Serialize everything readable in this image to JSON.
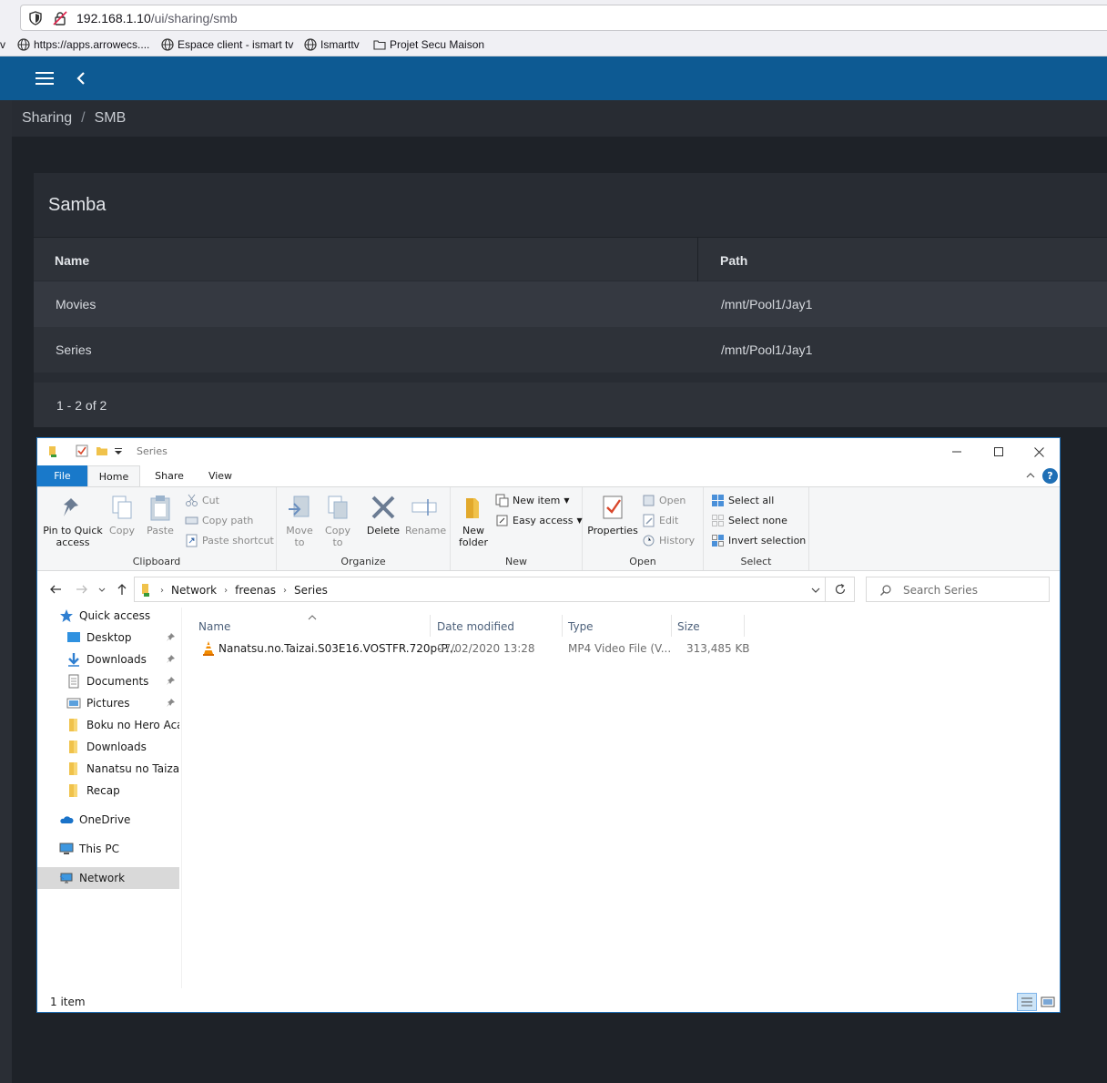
{
  "browser": {
    "url_host": "192.168.1.10",
    "url_path": "/ui/sharing/smb",
    "bookmarks": [
      {
        "label": "https://apps.arrowecs...."
      },
      {
        "label": "Espace client - ismart tv"
      },
      {
        "label": "Ismarttv"
      },
      {
        "label": "Projet Secu Maison"
      }
    ],
    "bookmark_edge": "v"
  },
  "app": {
    "breadcrumb": [
      "Sharing",
      "SMB"
    ],
    "breadcrumb_separator": "/",
    "card_title": "Samba",
    "columns": [
      "Name",
      "Path"
    ],
    "rows": [
      {
        "name": "Movies",
        "path": "/mnt/Pool1/Jay1"
      },
      {
        "name": "Series",
        "path": "/mnt/Pool1/Jay1"
      }
    ],
    "pagination": "1 - 2 of 2",
    "colors": {
      "topbar": "#0d5a93",
      "card": "#282c33",
      "background": "#1e2228"
    }
  },
  "explorer": {
    "title": "Series",
    "tabs": {
      "file": "File",
      "home": "Home",
      "share": "Share",
      "view": "View"
    },
    "ribbon": {
      "clipboard": {
        "label": "Clipboard",
        "pin": "Pin to Quick access",
        "copy": "Copy",
        "paste": "Paste",
        "cut": "Cut",
        "copy_path": "Copy path",
        "paste_shortcut": "Paste shortcut"
      },
      "organize": {
        "label": "Organize",
        "move_to": "Move to",
        "copy_to": "Copy to",
        "delete": "Delete",
        "rename": "Rename"
      },
      "new": {
        "label": "New",
        "new_folder": "New folder",
        "new_item": "New item",
        "easy_access": "Easy access"
      },
      "open": {
        "label": "Open",
        "properties": "Properties",
        "open": "Open",
        "edit": "Edit",
        "history": "History"
      },
      "select": {
        "label": "Select",
        "select_all": "Select all",
        "select_none": "Select none",
        "invert": "Invert selection"
      }
    },
    "address": [
      "Network",
      "freenas",
      "Series"
    ],
    "search_placeholder": "Search Series",
    "nav": [
      {
        "label": "Quick access"
      },
      {
        "label": "Desktop"
      },
      {
        "label": "Downloads"
      },
      {
        "label": "Documents"
      },
      {
        "label": "Pictures"
      },
      {
        "label": "Boku no Hero Acad"
      },
      {
        "label": "Downloads"
      },
      {
        "label": "Nanatsu no Taizai"
      },
      {
        "label": "Recap"
      },
      {
        "label": "OneDrive"
      },
      {
        "label": "This PC"
      },
      {
        "label": "Network"
      }
    ],
    "columns": [
      "Name",
      "Date modified",
      "Type",
      "Size"
    ],
    "files": [
      {
        "name": "Nanatsu.no.Taizai.S03E16.VOSTFR.720p-P...",
        "date": "07/02/2020 13:28",
        "type": "MP4 Video File (V...",
        "size": "313,485 KB",
        "icon": "vlc-cone-icon"
      }
    ],
    "status": "1 item"
  }
}
